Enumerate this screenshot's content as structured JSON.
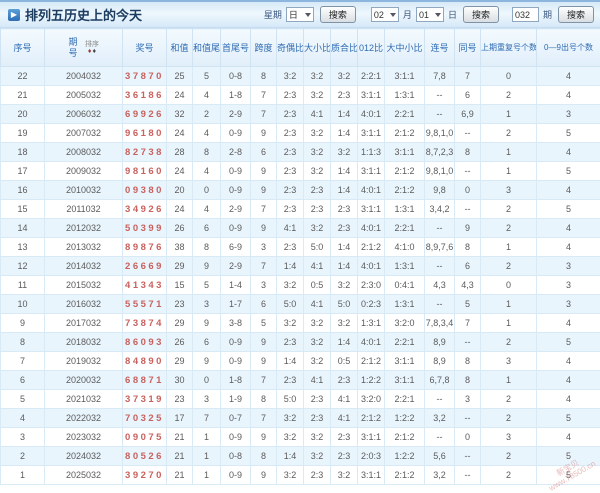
{
  "page": {
    "title": "排列五历史上的今天"
  },
  "controls": {
    "week_label": "星期",
    "week_value": "日",
    "month_value": "02",
    "month_label": "月",
    "day_value": "01",
    "day_label": "日",
    "issue_value": "032",
    "issue_label": "期",
    "search_label": "搜索"
  },
  "table": {
    "sort_label": "排序",
    "headers": [
      {
        "label": "序号"
      },
      {
        "label": "期号"
      },
      {
        "label": "奖号"
      },
      {
        "label": "和值"
      },
      {
        "label": "和值尾"
      },
      {
        "label": "首尾号"
      },
      {
        "label": "跨度"
      },
      {
        "label": "奇偶比"
      },
      {
        "label": "大小比"
      },
      {
        "label": "质合比"
      },
      {
        "label": "012比"
      },
      {
        "label": "大中小比"
      },
      {
        "label": "连号"
      },
      {
        "label": "同号"
      },
      {
        "label": "上期重复号个数"
      },
      {
        "label": "0—9出号个数"
      }
    ]
  },
  "rows": [
    [
      "22",
      "2004032",
      "37870",
      "25",
      "5",
      "0-8",
      "8",
      "3:2",
      "3:2",
      "3:2",
      "2:2:1",
      "3:1:1",
      "7,8",
      "7",
      "0",
      "4"
    ],
    [
      "21",
      "2005032",
      "36186",
      "24",
      "4",
      "1-8",
      "7",
      "2:3",
      "3:2",
      "2:3",
      "3:1:1",
      "1:3:1",
      "--",
      "6",
      "2",
      "4"
    ],
    [
      "20",
      "2006032",
      "69926",
      "32",
      "2",
      "2-9",
      "7",
      "2:3",
      "4:1",
      "1:4",
      "4:0:1",
      "2:2:1",
      "--",
      "6,9",
      "1",
      "3"
    ],
    [
      "19",
      "2007032",
      "96180",
      "24",
      "4",
      "0-9",
      "9",
      "2:3",
      "3:2",
      "1:4",
      "3:1:1",
      "2:1:2",
      "9,8,1,0",
      "--",
      "2",
      "5"
    ],
    [
      "18",
      "2008032",
      "82738",
      "28",
      "8",
      "2-8",
      "6",
      "2:3",
      "3:2",
      "3:2",
      "1:1:3",
      "3:1:1",
      "8,7,2,3",
      "8",
      "1",
      "4"
    ],
    [
      "17",
      "2009032",
      "98160",
      "24",
      "4",
      "0-9",
      "9",
      "2:3",
      "3:2",
      "1:4",
      "3:1:1",
      "2:1:2",
      "9,8,1,0",
      "--",
      "1",
      "5"
    ],
    [
      "16",
      "2010032",
      "09380",
      "20",
      "0",
      "0-9",
      "9",
      "2:3",
      "2:3",
      "1:4",
      "4:0:1",
      "2:1:2",
      "9,8",
      "0",
      "3",
      "4"
    ],
    [
      "15",
      "2011032",
      "34926",
      "24",
      "4",
      "2-9",
      "7",
      "2:3",
      "2:3",
      "2:3",
      "3:1:1",
      "1:3:1",
      "3,4,2",
      "--",
      "2",
      "5"
    ],
    [
      "14",
      "2012032",
      "50399",
      "26",
      "6",
      "0-9",
      "9",
      "4:1",
      "3:2",
      "2:3",
      "4:0:1",
      "2:2:1",
      "--",
      "9",
      "2",
      "4"
    ],
    [
      "13",
      "2013032",
      "89876",
      "38",
      "8",
      "6-9",
      "3",
      "2:3",
      "5:0",
      "1:4",
      "2:1:2",
      "4:1:0",
      "8,9,7,6",
      "8",
      "1",
      "4"
    ],
    [
      "12",
      "2014032",
      "26669",
      "29",
      "9",
      "2-9",
      "7",
      "1:4",
      "4:1",
      "1:4",
      "4:0:1",
      "1:3:1",
      "--",
      "6",
      "2",
      "3"
    ],
    [
      "11",
      "2015032",
      "41343",
      "15",
      "5",
      "1-4",
      "3",
      "3:2",
      "0:5",
      "3:2",
      "2:3:0",
      "0:4:1",
      "4,3",
      "4,3",
      "0",
      "3"
    ],
    [
      "10",
      "2016032",
      "55571",
      "23",
      "3",
      "1-7",
      "6",
      "5:0",
      "4:1",
      "5:0",
      "0:2:3",
      "1:3:1",
      "--",
      "5",
      "1",
      "3"
    ],
    [
      "9",
      "2017032",
      "73874",
      "29",
      "9",
      "3-8",
      "5",
      "3:2",
      "3:2",
      "3:2",
      "1:3:1",
      "3:2:0",
      "7,8,3,4",
      "7",
      "1",
      "4"
    ],
    [
      "8",
      "2018032",
      "86093",
      "26",
      "6",
      "0-9",
      "9",
      "2:3",
      "3:2",
      "1:4",
      "4:0:1",
      "2:2:1",
      "8,9",
      "--",
      "2",
      "5"
    ],
    [
      "7",
      "2019032",
      "84890",
      "29",
      "9",
      "0-9",
      "9",
      "1:4",
      "3:2",
      "0:5",
      "2:1:2",
      "3:1:1",
      "8,9",
      "8",
      "3",
      "4"
    ],
    [
      "6",
      "2020032",
      "68871",
      "30",
      "0",
      "1-8",
      "7",
      "2:3",
      "4:1",
      "2:3",
      "1:2:2",
      "3:1:1",
      "6,7,8",
      "8",
      "1",
      "4"
    ],
    [
      "5",
      "2021032",
      "37319",
      "23",
      "3",
      "1-9",
      "8",
      "5:0",
      "2:3",
      "4:1",
      "3:2:0",
      "2:2:1",
      "--",
      "3",
      "2",
      "4"
    ],
    [
      "4",
      "2022032",
      "70325",
      "17",
      "7",
      "0-7",
      "7",
      "3:2",
      "2:3",
      "4:1",
      "2:1:2",
      "1:2:2",
      "3,2",
      "--",
      "2",
      "5"
    ],
    [
      "3",
      "2023032",
      "09075",
      "21",
      "1",
      "0-9",
      "9",
      "3:2",
      "3:2",
      "2:3",
      "3:1:1",
      "2:1:2",
      "--",
      "0",
      "3",
      "4"
    ],
    [
      "2",
      "2024032",
      "80526",
      "21",
      "1",
      "0-8",
      "8",
      "1:4",
      "3:2",
      "2:3",
      "2:0:3",
      "1:2:2",
      "5,6",
      "--",
      "2",
      "5"
    ],
    [
      "1",
      "2025032",
      "39270",
      "21",
      "1",
      "0-9",
      "9",
      "3:2",
      "2:3",
      "3:2",
      "3:1:1",
      "2:1:2",
      "3,2",
      "--",
      "2",
      "5"
    ]
  ],
  "watermark": {
    "line1": "新宝贝",
    "line2": "www.78500.cn"
  },
  "colors": {
    "accent_blue": "#2f6cb3",
    "prize_red": "#c9625f",
    "row_alt_blue": "#e9f5fd",
    "grid_border": "#d9eaf7",
    "titlebar_top": "#8cb6de"
  }
}
